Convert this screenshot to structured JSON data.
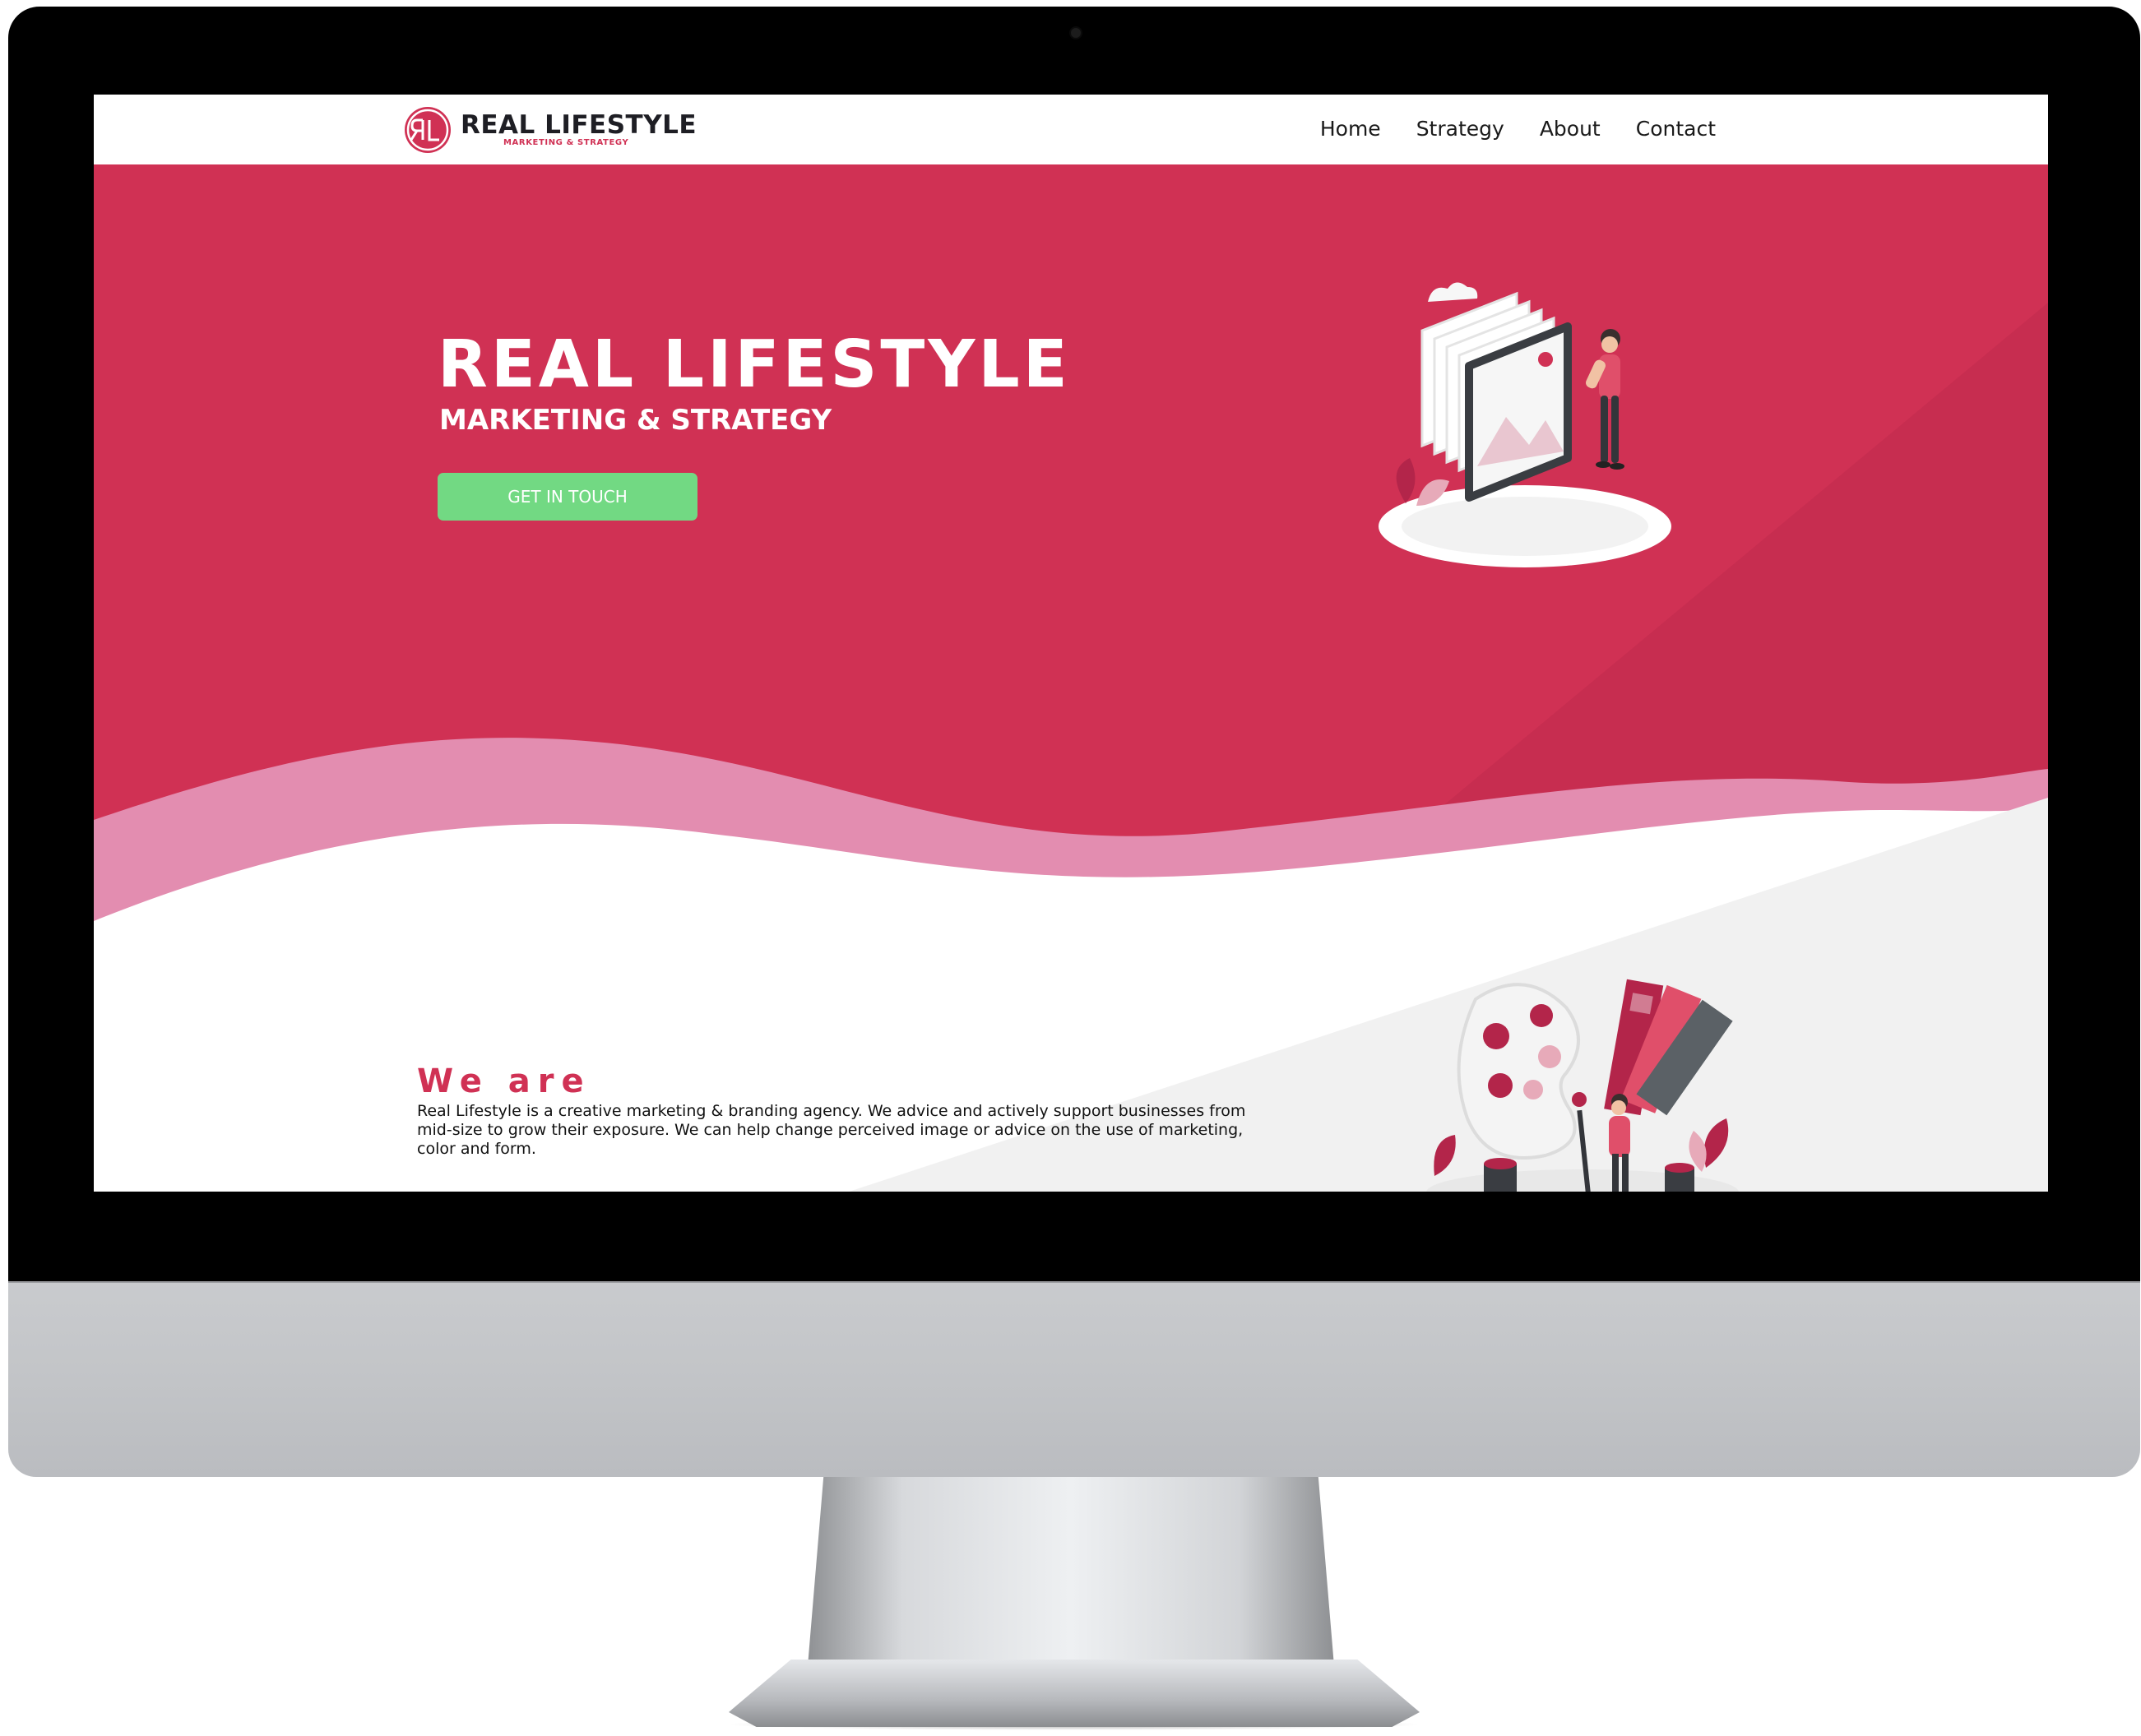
{
  "brand": {
    "mark": "RL",
    "name": "REAL LIFESTYLE",
    "tagline": "MARKETING & STRATEGY"
  },
  "nav": {
    "items": [
      {
        "label": "Home"
      },
      {
        "label": "Strategy"
      },
      {
        "label": "About"
      },
      {
        "label": "Contact"
      }
    ]
  },
  "hero": {
    "title": "REAL LIFESTYLE",
    "subtitle": "MARKETING & STRATEGY",
    "cta_label": "GET IN TOUCH"
  },
  "about": {
    "heading": "We are",
    "body": "Real Lifestyle is a creative marketing & branding agency. We advice and actively support businesses from mid-size to grow their exposure. We can help change perceived image or advice on the use of marketing, color and form."
  },
  "colors": {
    "brand": "#d03154",
    "wave_light": "#e38db0",
    "cta_green": "#72d983",
    "text_dark": "#1e1e24"
  },
  "icons": [
    "camera-icon",
    "brand-logo-icon",
    "presentation-illustration",
    "painter-illustration"
  ]
}
